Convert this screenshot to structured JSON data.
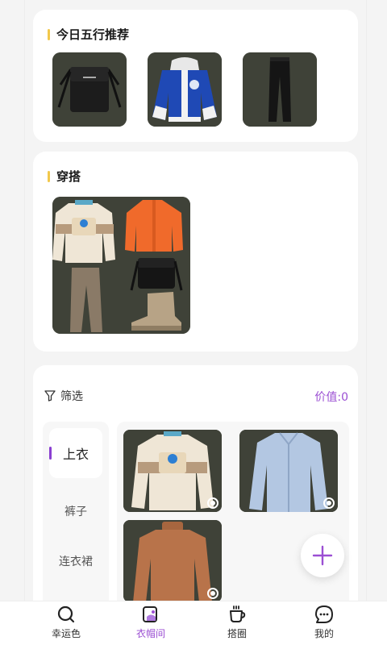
{
  "recommend": {
    "title": "今日五行推荐",
    "items": [
      {
        "icon": "shoulder-bag"
      },
      {
        "icon": "blue-varsity-jacket"
      },
      {
        "icon": "black-trousers"
      }
    ]
  },
  "outfit": {
    "title": "穿搭"
  },
  "filter": {
    "label": "筛选",
    "value_label": "价值:",
    "value": "0"
  },
  "categories": [
    {
      "label": "上衣",
      "active": true
    },
    {
      "label": "裤子",
      "active": false
    },
    {
      "label": "连衣裙",
      "active": false
    }
  ],
  "wardrobe_items": [
    {
      "icon": "cream-sweatshirt",
      "selected": true
    },
    {
      "icon": "light-blue-shirt",
      "selected": true
    },
    {
      "icon": "brown-turtleneck",
      "selected": true
    }
  ],
  "tabs": [
    {
      "label": "幸运色",
      "icon": "search-icon",
      "active": false
    },
    {
      "label": "衣帽间",
      "icon": "wardrobe-icon",
      "active": true
    },
    {
      "label": "搭圈",
      "icon": "cup-icon",
      "active": false
    },
    {
      "label": "我的",
      "icon": "chat-icon",
      "active": false
    }
  ],
  "colors": {
    "accent": "#9b4fd3",
    "title_bar": "#f2c84b",
    "thumb_bg": "#3f4238"
  }
}
